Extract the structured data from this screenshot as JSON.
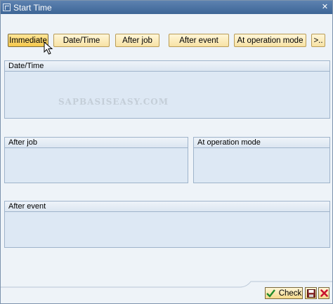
{
  "window": {
    "title": "Start Time",
    "close_glyph": "✕"
  },
  "tabs": [
    {
      "label": "Immediate",
      "active": true
    },
    {
      "label": "Date/Time",
      "active": false
    },
    {
      "label": "After job",
      "active": false
    },
    {
      "label": "After event",
      "active": false
    },
    {
      "label": "At operation mode",
      "active": false
    },
    {
      "label": ">..",
      "active": false
    }
  ],
  "groups": {
    "date_time": "Date/Time",
    "after_job": "After job",
    "at_operation_mode": "At operation mode",
    "after_event": "After event"
  },
  "watermark": "SAPBASISEASY.COM",
  "footer": {
    "check_label": "Check",
    "check_icon": "checkmark-icon",
    "save_icon": "save-icon",
    "cancel_icon": "cancel-icon"
  },
  "colors": {
    "title_bar": "#3d6596",
    "button_face": "#f7e2a4",
    "group_fill": "#dde8f4",
    "cancel_red": "#c8102e",
    "check_green": "#1f8a2a"
  }
}
